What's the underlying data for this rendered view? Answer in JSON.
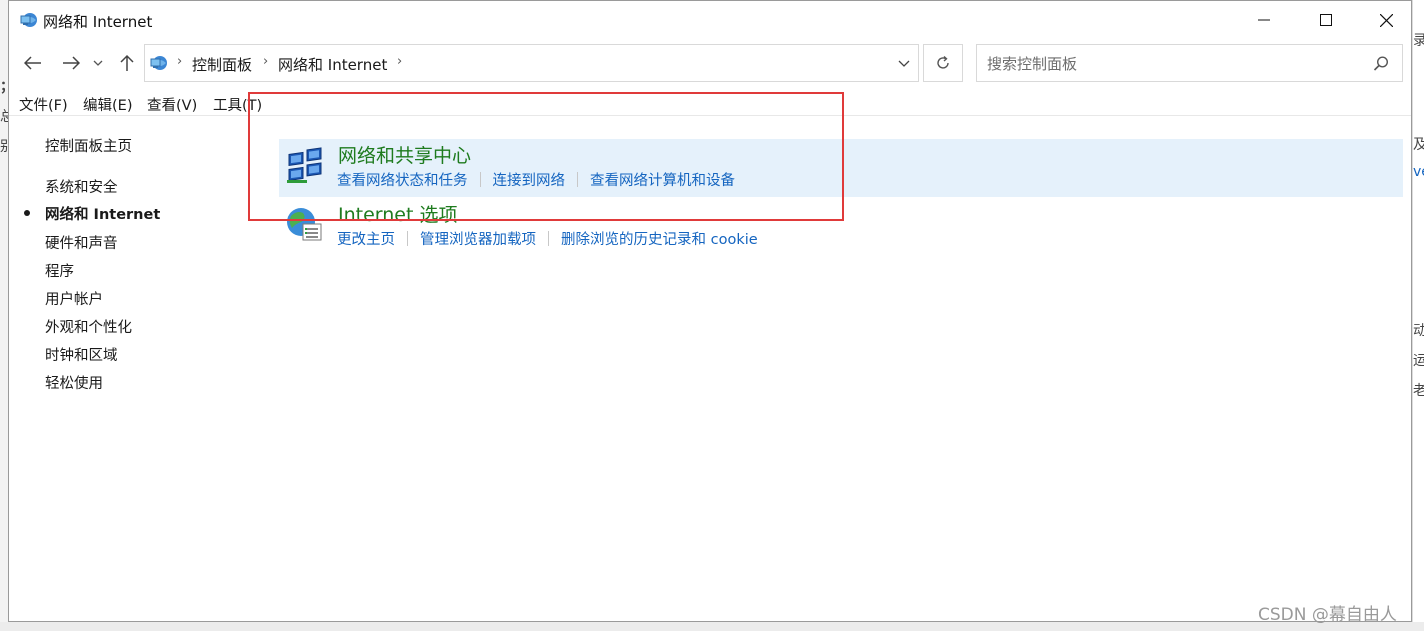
{
  "window": {
    "title": "网络和 Internet",
    "minimize_icon": "minimize-icon",
    "maximize_icon": "maximize-icon",
    "close_icon": "close-icon"
  },
  "address_bar": {
    "breadcrumbs": [
      "控制面板",
      "网络和 Internet"
    ],
    "icon": "control-panel-icon"
  },
  "search": {
    "placeholder": "搜索控制面板"
  },
  "menu": [
    "文件(F)",
    "编辑(E)",
    "查看(V)",
    "工具(T)"
  ],
  "sidebar": {
    "home": "控制面板主页",
    "items": [
      {
        "label": "系统和安全",
        "active": false
      },
      {
        "label": "网络和 Internet",
        "active": true
      },
      {
        "label": "硬件和声音",
        "active": false
      },
      {
        "label": "程序",
        "active": false
      },
      {
        "label": "用户帐户",
        "active": false
      },
      {
        "label": "外观和个性化",
        "active": false
      },
      {
        "label": "时钟和区域",
        "active": false
      },
      {
        "label": "轻松使用",
        "active": false
      }
    ]
  },
  "categories": [
    {
      "title": "网络和共享中心",
      "icon": "network-sharing-icon",
      "highlighted": true,
      "links": [
        "查看网络状态和任务",
        "连接到网络",
        "查看网络计算机和设备"
      ]
    },
    {
      "title": "Internet 选项",
      "icon": "internet-options-icon",
      "highlighted": false,
      "links": [
        "更改主页",
        "管理浏览器加载项",
        "删除浏览的历史记录和 cookie"
      ]
    }
  ],
  "watermark": "CSDN @幕自由人",
  "colors": {
    "category_title": "#1e7b1e",
    "link": "#1565c0",
    "highlight": "#e5f1fb",
    "annotation_box": "#e03a3a"
  },
  "background_fragments": [
    "；",
    "总",
    "别",
    "录",
    "及、",
    "ve",
    "动",
    "运",
    "老"
  ]
}
